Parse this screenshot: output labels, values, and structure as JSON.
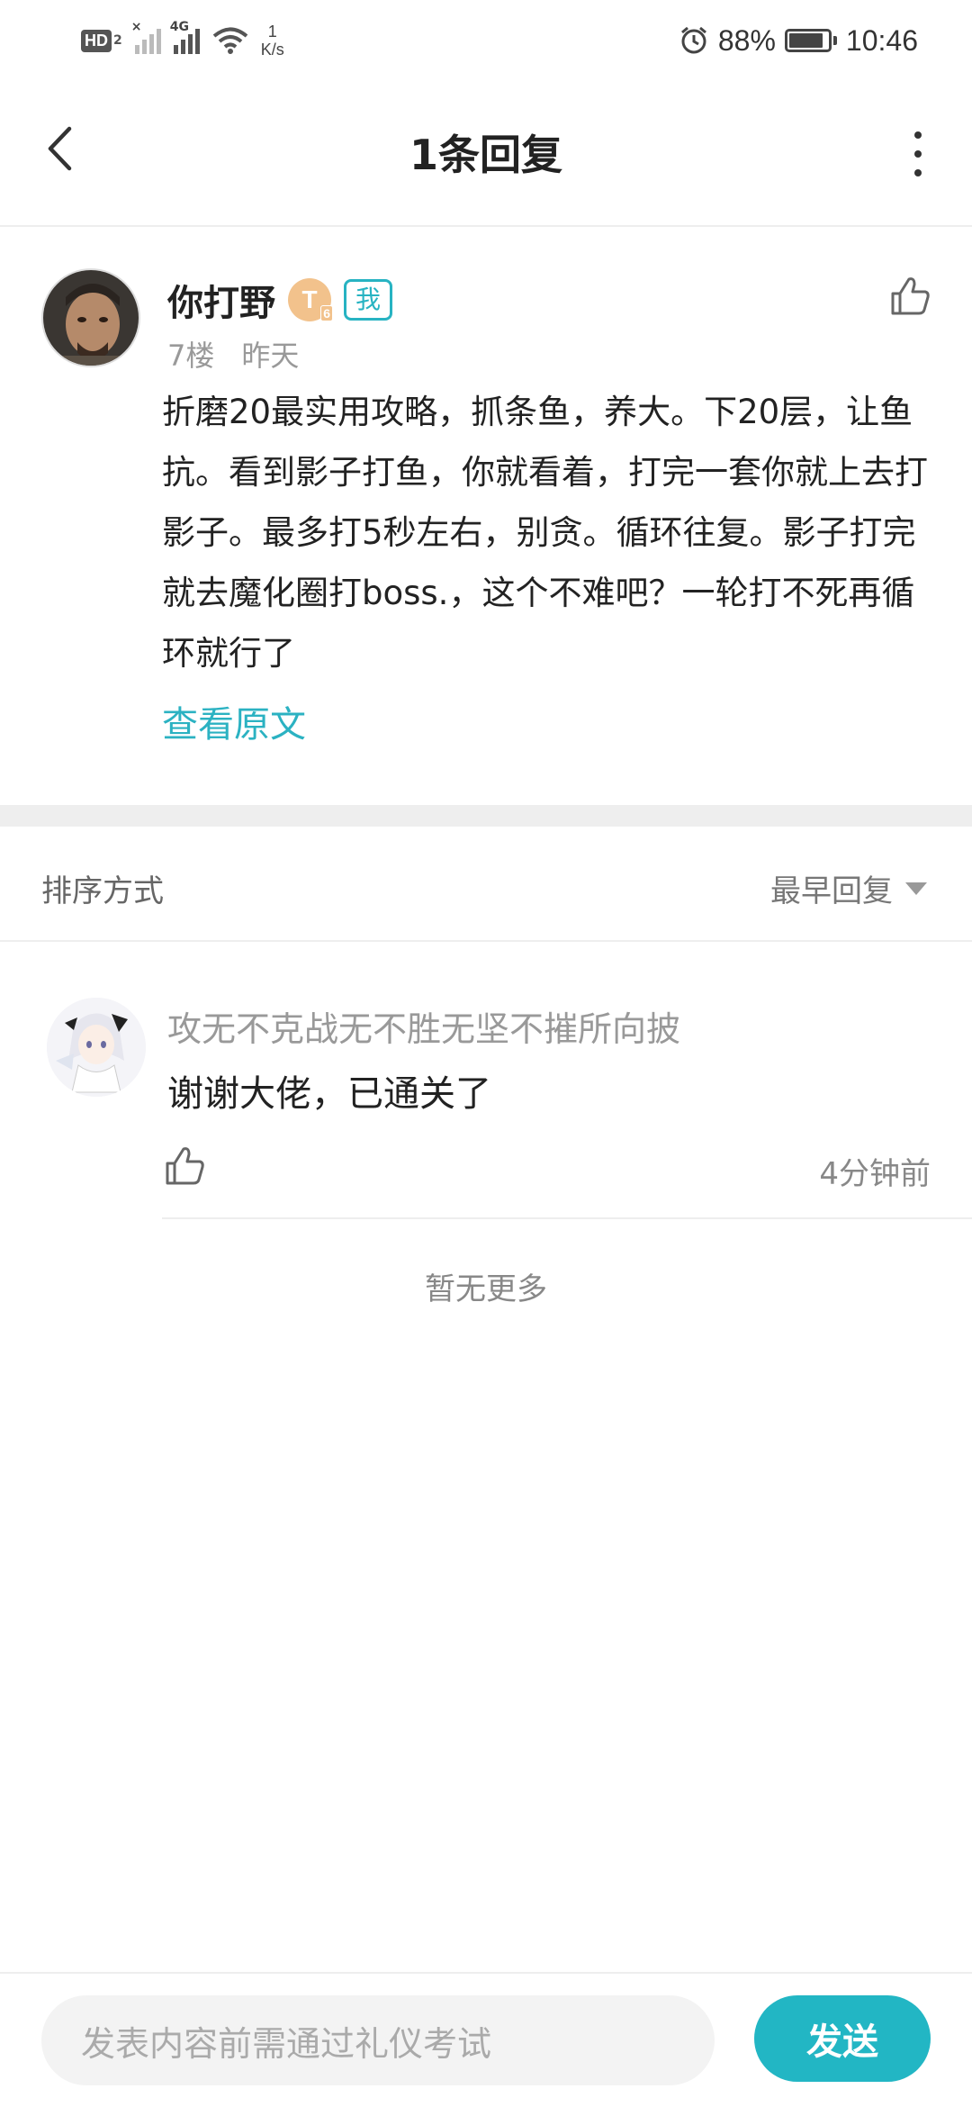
{
  "status_bar": {
    "hd_label": "HD",
    "hd_sub": "2",
    "sim1_tag": "×",
    "sim2_tag": "4G",
    "net_speed_value": "1",
    "net_speed_unit": "K/s",
    "battery_percent": "88%",
    "battery_level": 0.88,
    "time": "10:46"
  },
  "header": {
    "title": "1条回复",
    "back_icon": "chevron-left-icon",
    "more_icon": "more-vertical-icon"
  },
  "post": {
    "author": "你打野",
    "level_badge": "T",
    "level_num": "6",
    "me_badge": "我",
    "floor": "7楼",
    "date": "昨天",
    "content": "折磨20最实用攻略，抓条鱼，养大。下20层，让鱼抗。看到影子打鱼，你就看着，打完一套你就上去打影子。最多打5秒左右，别贪。循环往复。影子打完就去魔化圈打boss.，这个不难吧？一轮打不死再循环就行了",
    "view_original": "查看原文"
  },
  "sort": {
    "label": "排序方式",
    "selected": "最早回复"
  },
  "replies": [
    {
      "user": "攻无不克战无不胜无坚不摧所向披",
      "text": "谢谢大佬，已通关了",
      "time": "4分钟前"
    }
  ],
  "no_more": "暂无更多",
  "composer": {
    "placeholder": "发表内容前需通过礼仪考试",
    "send_label": "发送"
  },
  "colors": {
    "accent": "#22b6c4",
    "link": "#2bb2c2",
    "level_badge": "#f2c28c"
  }
}
